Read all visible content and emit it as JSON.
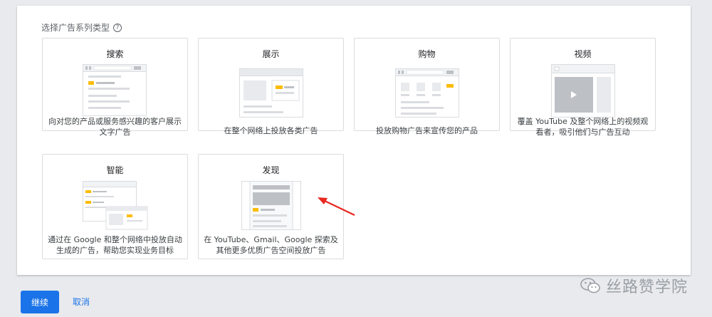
{
  "section": {
    "label": "选择广告系列类型",
    "help_icon": "question-circle-icon"
  },
  "cards": [
    {
      "title": "搜索",
      "desc": "向对您的产品或服务感兴趣的客户展示文字广告"
    },
    {
      "title": "展示",
      "desc": "在整个网络上投放各类广告"
    },
    {
      "title": "购物",
      "desc": "投放购物广告来宣传您的产品"
    },
    {
      "title": "视频",
      "desc": "覆盖 YouTube 及整个网络上的视频观看者，吸引他们与广告互动"
    },
    {
      "title": "智能",
      "desc": "通过在 Google 和整个网络中投放自动生成的广告，帮助您实现业务目标"
    },
    {
      "title": "发现",
      "desc": "在 YouTube、Gmail、Google 探索及其他更多优质广告空间投放广告"
    }
  ],
  "actions": {
    "continue_label": "继续",
    "cancel_label": "取消"
  },
  "watermark": {
    "text": "丝路赞学院",
    "icon": "wechat-icon"
  },
  "colors": {
    "primary": "#1a73e8",
    "accent_yellow": "#fbbc04",
    "arrow_red": "#e8271f"
  }
}
